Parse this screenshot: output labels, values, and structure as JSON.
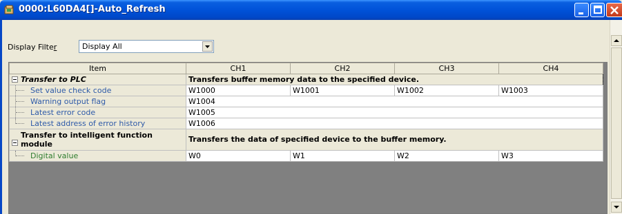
{
  "window": {
    "title": "0000:L60DA4[]-Auto_Refresh"
  },
  "filter": {
    "label_pre": "Display Filte",
    "label_accel": "r",
    "value": "Display All"
  },
  "grid": {
    "headers": [
      "Item",
      "CH1",
      "CH2",
      "CH3",
      "CH4"
    ],
    "groups": [
      {
        "label": "Transfer to PLC",
        "description": "Transfers buffer memory data to the specified device.",
        "rows": [
          {
            "label": "Set value check code",
            "values": [
              "W1000",
              "W1001",
              "W1002",
              "W1003"
            ]
          },
          {
            "label": "Warning output flag",
            "values": [
              "W1004"
            ]
          },
          {
            "label": "Latest error code",
            "values": [
              "W1005"
            ]
          },
          {
            "label": "Latest address of error history",
            "values": [
              "W1006"
            ]
          }
        ]
      },
      {
        "label": "Transfer to intelligent function module",
        "description": "Transfers the data of specified device to the buffer memory.",
        "rows": [
          {
            "label": "Digital value",
            "values": [
              "W0",
              "W1",
              "W2",
              "W3"
            ]
          }
        ]
      }
    ]
  },
  "colors": {
    "titlebar": "#0052d8",
    "item_text": "#2e5aa8",
    "digital_text": "#2e7d2e",
    "panel_bg": "#808080"
  }
}
